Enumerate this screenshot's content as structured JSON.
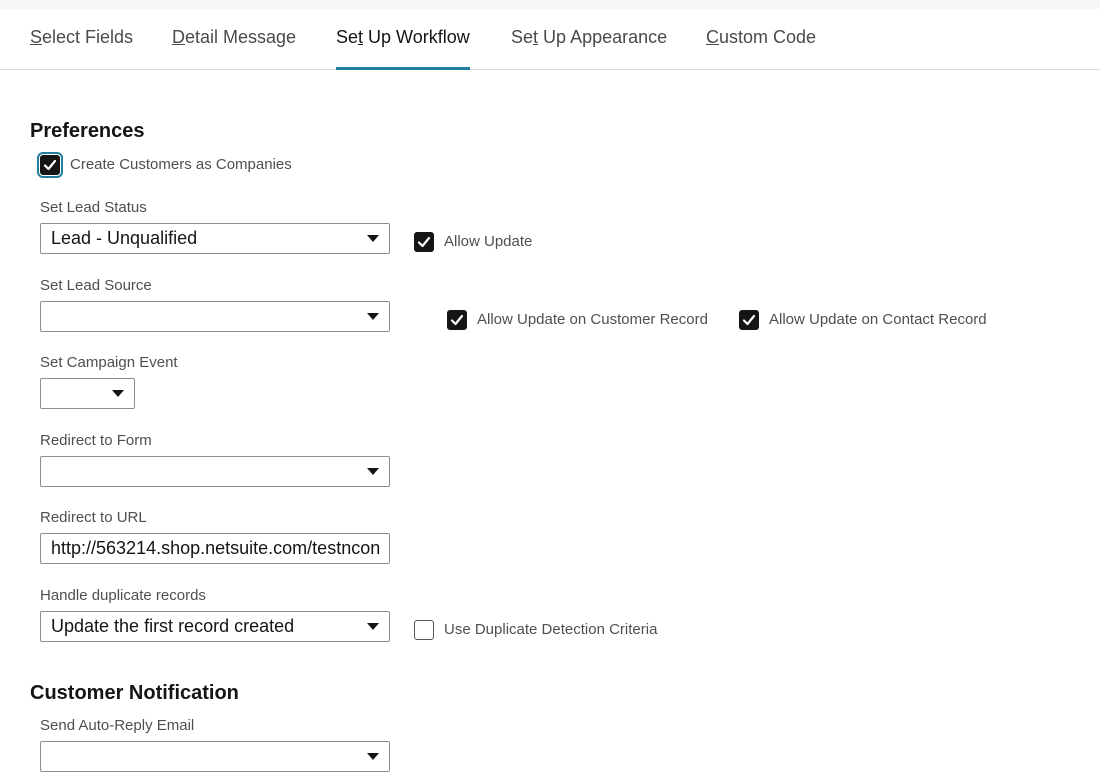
{
  "tabs": [
    {
      "accel": "S",
      "rest": "elect Fields"
    },
    {
      "accel": "D",
      "rest": "etail Message"
    },
    {
      "pre": "Se",
      "accel": "t",
      "rest": " Up Workflow"
    },
    {
      "pre": "Se",
      "accel": "t",
      "rest": " Up Appearance"
    },
    {
      "accel": "C",
      "rest": "ustom Code"
    }
  ],
  "active_tab": "Set Up Workflow",
  "colors": {
    "accent": "#227e9e",
    "checkbox": "#161513"
  },
  "preferences": {
    "title": "Preferences",
    "create_customers_as_companies": {
      "label": "Create Customers as Companies",
      "checked": true
    },
    "lead_status": {
      "label": "Set Lead Status",
      "value": "Lead - Unqualified"
    },
    "allow_update": {
      "label": "Allow Update",
      "checked": true
    },
    "lead_source": {
      "label": "Set Lead Source",
      "value": ""
    },
    "allow_update_customer": {
      "label": "Allow Update on Customer Record",
      "checked": true
    },
    "allow_update_contact": {
      "label": "Allow Update on Contact Record",
      "checked": true
    },
    "campaign_event": {
      "label": "Set Campaign Event",
      "value": ""
    },
    "redirect_form": {
      "label": "Redirect to Form",
      "value": ""
    },
    "redirect_url": {
      "label": "Redirect to URL",
      "value": "http://563214.shop.netsuite.com/testncon"
    },
    "duplicates": {
      "label": "Handle duplicate records",
      "value": "Update the first record created"
    },
    "use_duplicate_detection": {
      "label": "Use Duplicate Detection Criteria",
      "checked": false
    }
  },
  "customer_notification": {
    "title": "Customer Notification",
    "auto_reply": {
      "label": "Send Auto-Reply Email",
      "value": ""
    }
  },
  "icons": {
    "checkmark": "checkmark-icon",
    "dropdown": "chevron-down-icon"
  }
}
